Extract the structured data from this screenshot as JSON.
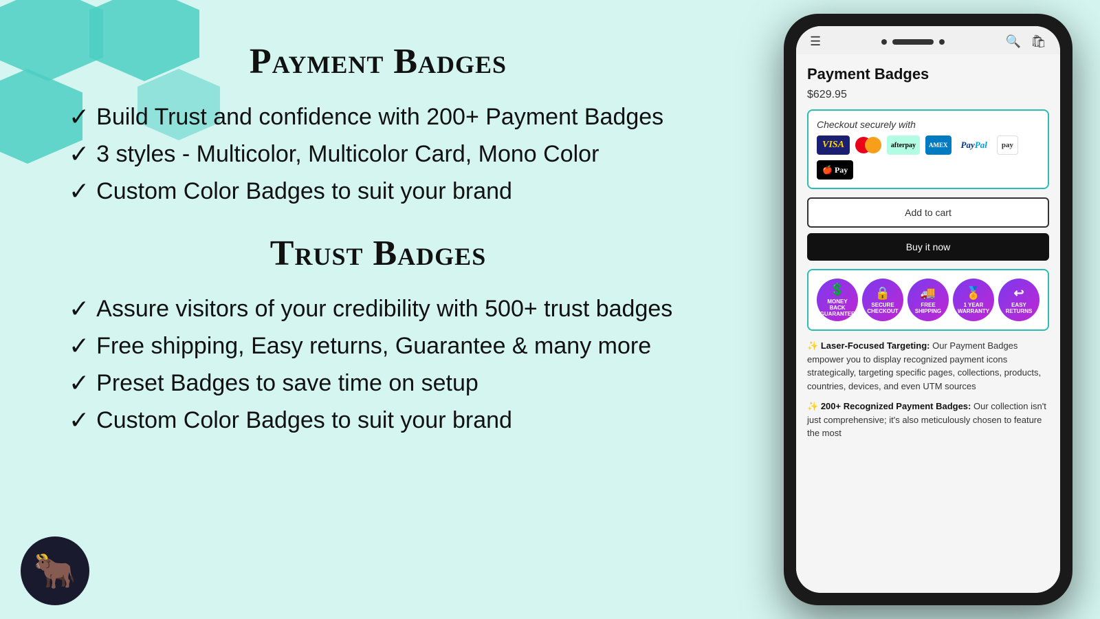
{
  "background_color": "#d4f5f0",
  "header": {
    "payment_badges_title": "Payment Badges",
    "trust_badges_title": "Trust Badges"
  },
  "payment_section": {
    "items": [
      "Build Trust and confidence with 200+ Payment Badges",
      "3 styles - Multicolor, Multicolor Card, Mono Color",
      "Custom Color Badges to suit your brand"
    ]
  },
  "trust_section": {
    "items": [
      "Assure visitors of your credibility with 500+ trust badges",
      "Free shipping, Easy returns, Guarantee & many more",
      "Preset Badges to save time on setup",
      "Custom Color Badges to suit your brand"
    ]
  },
  "phone": {
    "product_title": "Payment Badges",
    "price": "$629.95",
    "checkout_label": "Checkout securely with",
    "add_to_cart": "Add to cart",
    "buy_now": "Buy it now",
    "trust_badges": [
      {
        "label": "MONEY BACK GUARANTEE",
        "icon": "$"
      },
      {
        "label": "SECURE CHECKOUT",
        "icon": "🔒"
      },
      {
        "label": "FREE SHIPPING",
        "icon": "🚚"
      },
      {
        "label": "1 YEAR WARRANTY",
        "icon": "🏅"
      },
      {
        "label": "EASY RETURNS",
        "icon": "↩"
      }
    ],
    "desc1_sparkle": "✨",
    "desc1_bold": "Laser-Focused Targeting:",
    "desc1_text": " Our Payment Badges empower you to display recognized payment icons strategically, targeting specific pages, collections, products, countries, devices, and even UTM sources",
    "desc2_sparkle": "✨",
    "desc2_bold": "200+ Recognized Payment Badges:",
    "desc2_text": " Our collection isn't just comprehensive; it's also meticulously chosen to feature the most"
  }
}
